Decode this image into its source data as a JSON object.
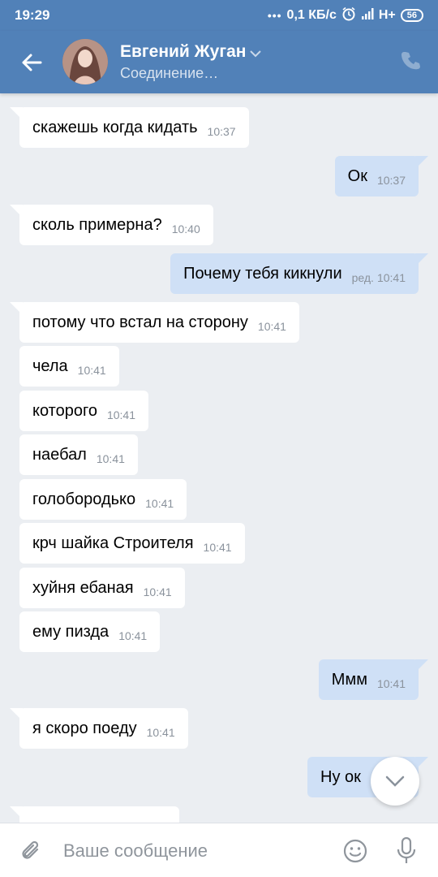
{
  "status_bar": {
    "time": "19:29",
    "network_speed": "0,1 КБ/с",
    "network_type": "H+",
    "battery": "56",
    "icons": [
      "dots-icon",
      "alarm-icon",
      "signal-icon",
      "battery-icon"
    ]
  },
  "header": {
    "contact_name": "Евгений Жуган",
    "status": "Соединение…",
    "icons": [
      "back-arrow-icon",
      "chevron-down-icon",
      "phone-icon"
    ]
  },
  "messages": [
    {
      "dir": "in",
      "text": "скажешь когда кидать",
      "time": "10:37"
    },
    {
      "dir": "out",
      "text": "Ок",
      "time": "10:37"
    },
    {
      "dir": "in",
      "text": "сколь примерна?",
      "time": "10:40"
    },
    {
      "dir": "out",
      "text": "Почему тебя кикнули",
      "time": "10:41",
      "edited": "ред."
    },
    {
      "dir": "in",
      "text": "потому что встал на сторону",
      "time": "10:41"
    },
    {
      "dir": "in",
      "text": "чела",
      "time": "10:41"
    },
    {
      "dir": "in",
      "text": "которого",
      "time": "10:41"
    },
    {
      "dir": "in",
      "text": "наебал",
      "time": "10:41"
    },
    {
      "dir": "in",
      "text": "голобородько",
      "time": "10:41"
    },
    {
      "dir": "in",
      "text": "крч шайка Строителя",
      "time": "10:41"
    },
    {
      "dir": "in",
      "text": "хуйня ебаная",
      "time": "10:41"
    },
    {
      "dir": "in",
      "text": "ему пизда",
      "time": "10:41"
    },
    {
      "dir": "out",
      "text": "Ммм",
      "time": "10:41"
    },
    {
      "dir": "in",
      "text": "я скоро поеду",
      "time": "10:41"
    },
    {
      "dir": "out",
      "text": "Ну ок",
      "time": ""
    }
  ],
  "input": {
    "placeholder": "Ваше сообщение",
    "icons": [
      "paperclip-icon",
      "emoji-icon",
      "microphone-icon"
    ]
  },
  "colors": {
    "header": "#5181b8",
    "background": "#ebeef2",
    "incoming_bubble": "#ffffff",
    "outgoing_bubble": "#cfe0f6",
    "time": "#8a929c"
  }
}
